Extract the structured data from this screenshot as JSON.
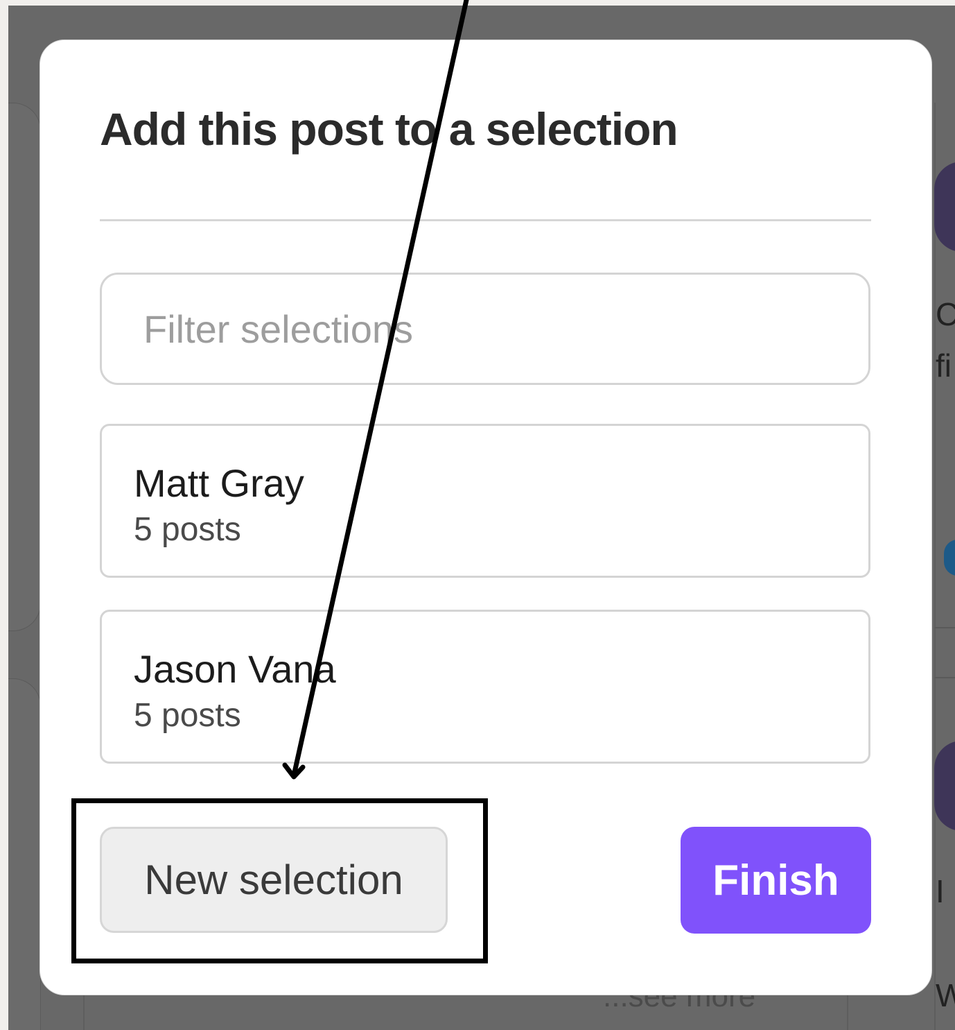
{
  "modal": {
    "title": "Add this post to a selection",
    "filter": {
      "placeholder": "Filter selections",
      "value": ""
    },
    "selections": [
      {
        "name": "Matt Gray",
        "count": "5 posts"
      },
      {
        "name": "Jason Vana",
        "count": "5 posts"
      }
    ],
    "new_selection_label": "New selection",
    "finish_label": "Finish",
    "accent_color": "#8052fb"
  },
  "background": {
    "see_more": "...see more",
    "right_column_fragments": [
      "C",
      "fi",
      "I",
      "W"
    ]
  },
  "annotation": {
    "type": "arrow-and-box",
    "target": "new-selection-button",
    "color": "#000000"
  }
}
